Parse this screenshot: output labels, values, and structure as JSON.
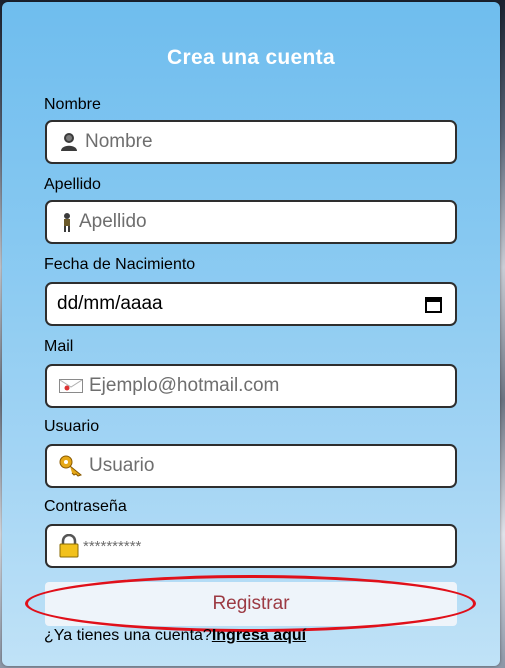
{
  "form": {
    "title": "Crea una cuenta",
    "fields": [
      {
        "label": "Nombre",
        "placeholder": "Nombre",
        "icon": "person-icon"
      },
      {
        "label": "Apellido",
        "placeholder": "Apellido",
        "icon": "figure-icon"
      },
      {
        "label": "Fecha de Nacimiento",
        "value": "dd/mm/aaaa",
        "icon": "calendar-icon"
      },
      {
        "label": "Mail",
        "placeholder": "Ejemplo@hotmail.com",
        "icon": "envelope-icon"
      },
      {
        "label": "Usuario",
        "placeholder": "Usuario",
        "icon": "key-icon"
      },
      {
        "label": "Contraseña",
        "placeholder": "**********",
        "icon": "lock-icon"
      }
    ],
    "submit_label": "Registrar",
    "footer_text": "¿Ya tienes una cuenta?",
    "footer_link": "Ingresa aquí"
  },
  "colors": {
    "highlight_ring": "#e0101a",
    "button_text": "#9c3a43"
  }
}
